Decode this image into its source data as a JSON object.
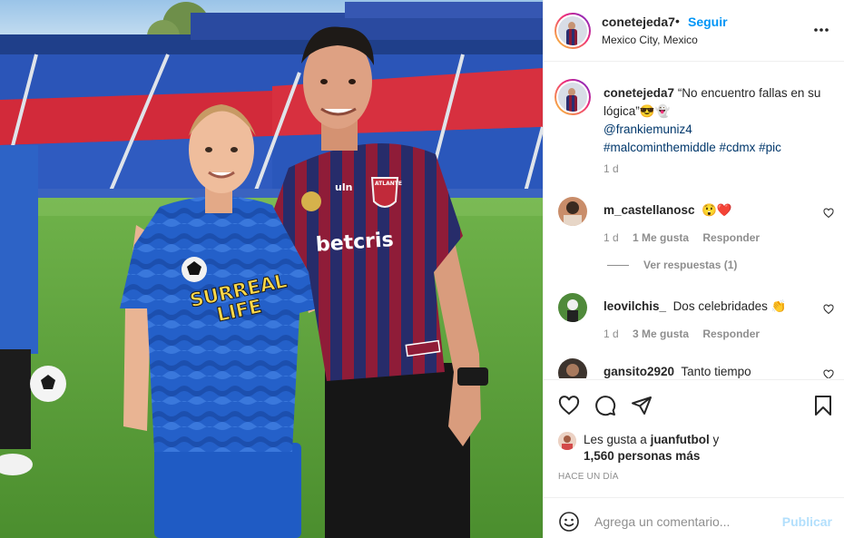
{
  "post": {
    "username": "conetejeda7",
    "separator": "•",
    "follow_label": "Seguir",
    "location": "Mexico City, Mexico"
  },
  "photo": {
    "jersey_left_text_1": "SURREAL",
    "jersey_left_text_2": "LIFE",
    "jersey_right_sponsor": "betcris",
    "jersey_right_brand": "uln",
    "crest_text": "ATLANTE"
  },
  "caption": {
    "username": "conetejeda7",
    "text": "“No encuentro fallas en su lógica”😎👻",
    "mention": "@frankiemuniz4",
    "hashtags": "#malcominthemiddle #cdmx #pic",
    "time": "1 d"
  },
  "comments": [
    {
      "username": "m_castellanosc",
      "text": "😲❤️",
      "time": "1 d",
      "likes": "1 Me gusta",
      "reply": "Responder"
    },
    {
      "username": "leovilchis_",
      "text": "Dos celebridades 👏",
      "time": "1 d",
      "likes": "3 Me gusta",
      "reply": "Responder"
    },
    {
      "username": "gansito2920",
      "text": "Tanto tiempo"
    }
  ],
  "view_replies": "Ver respuestas (1)",
  "likes": {
    "prefix": "Les gusta a ",
    "user": "juanfutbol",
    "suffix": " y",
    "count": "1,560 personas más"
  },
  "when": "HACE UN DÍA",
  "add_comment": {
    "placeholder": "Agrega un comentario...",
    "publish_label": "Publicar"
  },
  "colors": {
    "accent": "#0095f6",
    "text": "#262626",
    "muted": "#8e8e8e",
    "publish_disabled": "#b2dffc"
  },
  "icons": [
    "more-icon",
    "heart-icon",
    "comment-icon",
    "share-icon",
    "bookmark-icon",
    "emoji-icon"
  ]
}
